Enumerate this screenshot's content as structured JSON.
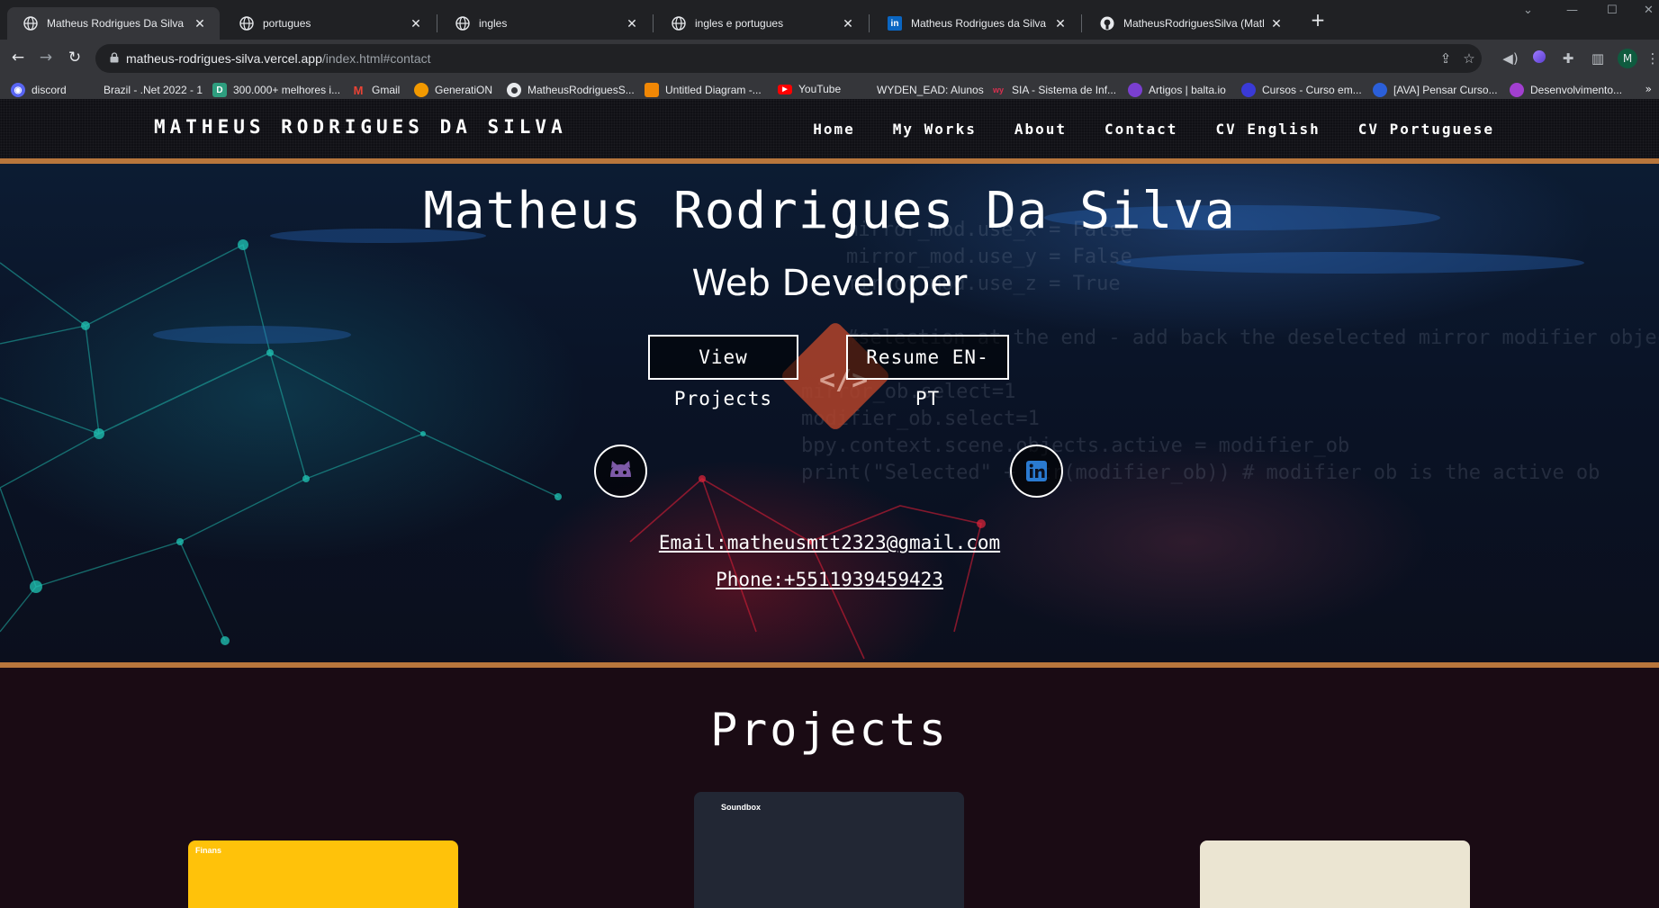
{
  "browser": {
    "tabs": [
      {
        "title": "Matheus Rodrigues Da Silva",
        "active": true,
        "icon": "globe-icon"
      },
      {
        "title": "portugues",
        "active": false,
        "icon": "globe-icon"
      },
      {
        "title": "ingles",
        "active": false,
        "icon": "globe-icon"
      },
      {
        "title": "ingles e portugues",
        "active": false,
        "icon": "globe-icon"
      },
      {
        "title": "Matheus Rodrigues da Silva | Link",
        "active": false,
        "icon": "linkedin-icon"
      },
      {
        "title": "MatheusRodriguesSilva (Matheu",
        "active": false,
        "icon": "github-icon"
      }
    ],
    "url_host": "matheus-rodrigues-silva.vercel.app",
    "url_path": "/index.html#contact",
    "profile_initial": "M",
    "bookmarks": [
      {
        "label": "discord",
        "icon": "discord-icon",
        "color": "#5865f2"
      },
      {
        "label": "Brazil - .Net 2022 - 1",
        "icon": "page-icon",
        "color": "#35363a"
      },
      {
        "label": "300.000+ melhores i...",
        "icon": "d-icon",
        "color": "#2e9e7f"
      },
      {
        "label": "Gmail",
        "icon": "gmail-icon",
        "color": "#ea4335"
      },
      {
        "label": "GeneratiON",
        "icon": "cloud-icon",
        "color": "#f29900"
      },
      {
        "label": "MatheusRodriguesS...",
        "icon": "github-icon",
        "color": "#e8eaed"
      },
      {
        "label": "Untitled Diagram -...",
        "icon": "drawio-icon",
        "color": "#f08705"
      },
      {
        "label": "YouTube",
        "icon": "youtube-icon",
        "color": "#ff0000"
      },
      {
        "label": "WYDEN_EAD: Alunos",
        "icon": "page-icon",
        "color": "#35363a"
      },
      {
        "label": "SIA - Sistema de Inf...",
        "icon": "wy-icon",
        "color": "#d9304f"
      },
      {
        "label": "Artigos | balta.io",
        "icon": "balta-icon",
        "color": "#7a3fd0"
      },
      {
        "label": "Cursos - Curso em...",
        "icon": "cursos-icon",
        "color": "#3a3ad6"
      },
      {
        "label": "[AVA] Pensar Curso...",
        "icon": "ava-icon",
        "color": "#2b5fd9"
      },
      {
        "label": "Desenvolvimento...",
        "icon": "dev-icon",
        "color": "#a23fd0"
      }
    ],
    "bookmarks_more": "»"
  },
  "site": {
    "brand": "MATHEUS RODRIGUES DA SILVA",
    "nav": [
      "Home",
      "My Works",
      "About",
      "Contact",
      "CV English",
      "CV Portuguese"
    ],
    "hero": {
      "title": "Matheus Rodrigues Da Silva",
      "subtitle": "Web Developer",
      "btn_projects": "View Projects",
      "btn_resume": "Resume EN-PT",
      "email": "Email:matheusmtt2323@gmail.com",
      "phone": "Phone:+5511939459423"
    },
    "projects": {
      "title": "Projects",
      "cards": [
        {
          "label": "Finans",
          "bg": "#ffc20a",
          "fg": "#ffffff"
        },
        {
          "label": "Soundbox",
          "bg": "#222734",
          "fg": "#ffffff"
        },
        {
          "label": "",
          "bg": "#ebe5d2",
          "fg": "#333333"
        }
      ]
    }
  },
  "colors": {
    "accent_border": "#b8763c",
    "nav_bg": "#101015",
    "projects_bg": "#1a0b14"
  }
}
